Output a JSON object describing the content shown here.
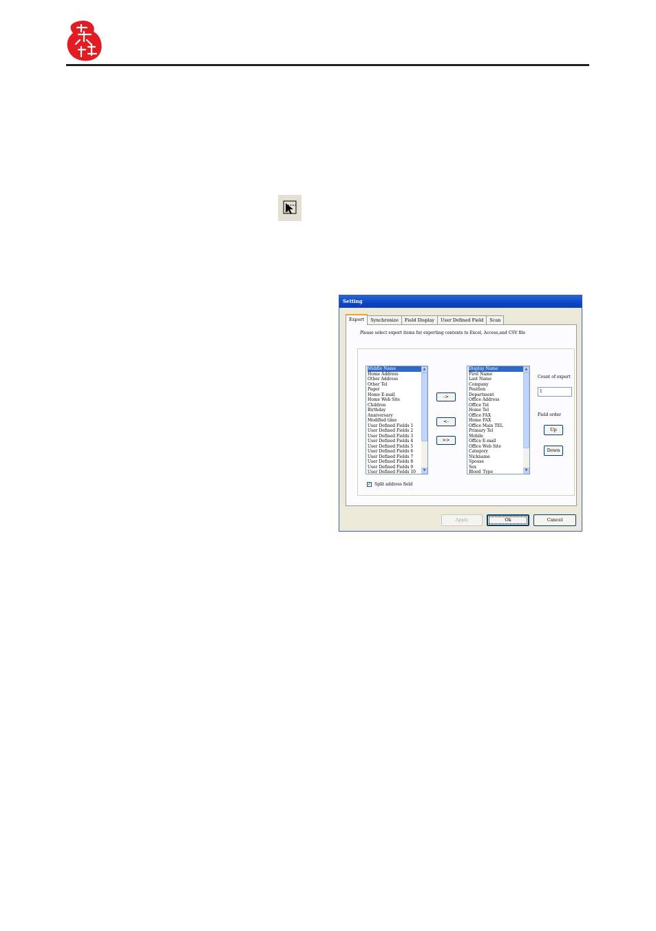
{
  "dialog": {
    "title": "Setting",
    "tabs": [
      {
        "label": "Export"
      },
      {
        "label": "Synchronize"
      },
      {
        "label": "Field Display"
      },
      {
        "label": "User Defined Field"
      },
      {
        "label": "Scan"
      }
    ],
    "instruction": "Please select export items for exporting contents to Excel, Access,and CSV file",
    "available_list": [
      "Middle Name",
      "Home Address",
      "Other Address",
      "Other Tel",
      "Pager",
      "Home E-mail",
      "Home Web Site",
      "Children",
      "Birthday",
      "Anniversary",
      "Modified time",
      "User Defined Fields 1",
      "User Defined Fields 2",
      "User Defined Fields 3",
      "User Defined Fields 4",
      "User Defined Fields 5",
      "User Defined Fields 6",
      "User Defined Fields 7",
      "User Defined Fields 8",
      "User Defined Fields 9",
      "User Defined Fields 10"
    ],
    "selected_list": [
      "Display Name",
      "First Name",
      "Last Name",
      "Company",
      "Position",
      "Department",
      "Office Address",
      "Office Tel",
      "Home Tel",
      "Office FAX",
      "Home FAX",
      "Office Main TEL",
      "Primary Tel",
      "Mobile",
      "Office E-mail",
      "Office Web Site",
      "Category",
      "Nickname",
      "Spouse",
      "Sex",
      "Blood_Type"
    ],
    "add_button": "->",
    "remove_button": "<-",
    "add_all_button": ">>",
    "count_label": "Count of export",
    "count_value": "1",
    "field_order_label": "Field order",
    "up_button": "Up",
    "down_button": "Down",
    "split_address_label": "Split address field",
    "split_address_checked": true,
    "check_mark": "✔",
    "scroll_up": "▲",
    "scroll_down": "▼",
    "apply_button": "Apply",
    "ok_button": "Ok",
    "cancel_button": "Cancel"
  },
  "icons": {
    "logo": "red-seal-logo",
    "select": "select-area-arrow-icon"
  },
  "colors": {
    "title_bar": "#0a46c8",
    "selection": "#316ac5",
    "dialog_bg": "#ece9d8",
    "logo_red": "#e31b23"
  }
}
